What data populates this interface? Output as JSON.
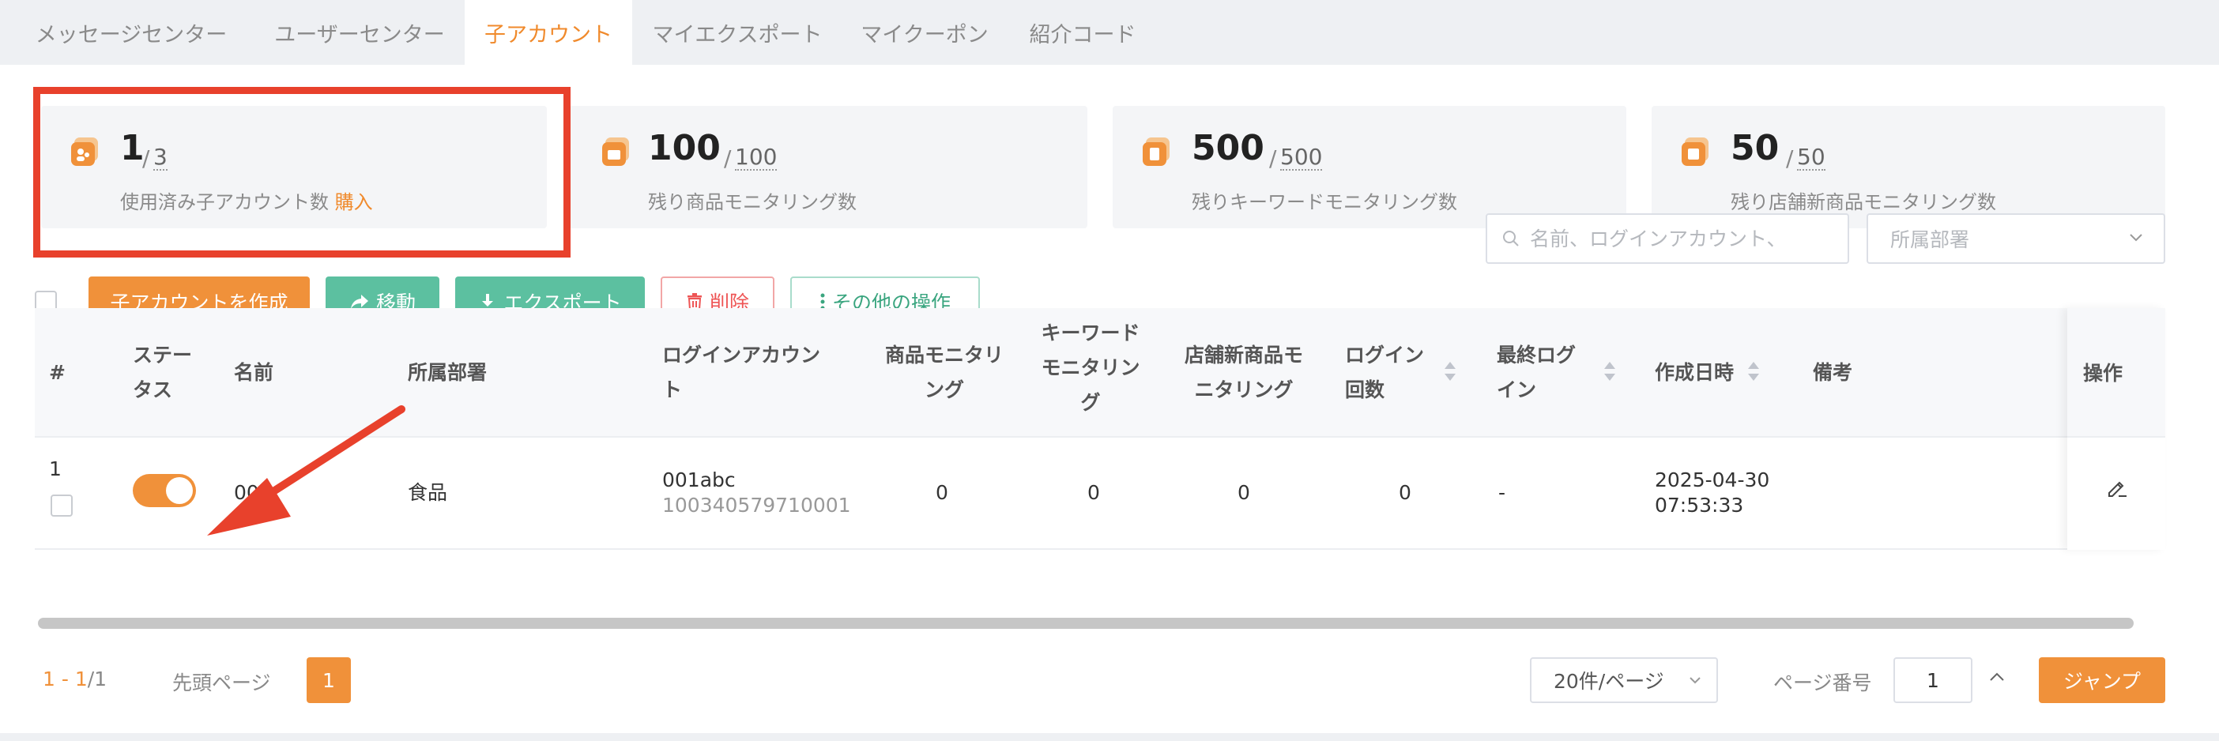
{
  "tabs": [
    {
      "label": "メッセージセンター",
      "active": false
    },
    {
      "label": "ユーザーセンター",
      "active": false
    },
    {
      "label": "子アカウント",
      "active": true
    },
    {
      "label": "マイエクスポート",
      "active": false
    },
    {
      "label": "マイクーポン",
      "active": false
    },
    {
      "label": "紹介コード",
      "active": false
    }
  ],
  "stats": [
    {
      "value": "1",
      "total": "3",
      "label": "使用済み子アカウント数",
      "action": "購入"
    },
    {
      "value": "100",
      "total": "100",
      "label": "残り商品モニタリング数"
    },
    {
      "value": "500",
      "total": "500",
      "label": "残りキーワードモニタリング数"
    },
    {
      "value": "50",
      "total": "50",
      "label": "残り店舗新商品モニタリング数"
    }
  ],
  "toolbar": {
    "create": "子アカウントを作成",
    "move": "移動",
    "export": "エクスポート",
    "delete": "削除",
    "more": "その他の操作",
    "search_placeholder": "名前、ログインアカウント、",
    "dept_placeholder": "所属部署"
  },
  "table": {
    "headers": {
      "index": "#",
      "status_1": "ステー",
      "status_2": "タス",
      "name": "名前",
      "dept": "所属部署",
      "login_1": "ログインアカウン",
      "login_2": "ト",
      "product_1": "商品モニタリ",
      "product_2": "ング",
      "keyword_1": "キーワード",
      "keyword_2": "モニタリン",
      "keyword_3": "グ",
      "shop_1": "店舗新商品モ",
      "shop_2": "ニタリング",
      "logins_1": "ログイン",
      "logins_2": "回数",
      "last_1": "最終ログ",
      "last_2": "イン",
      "created": "作成日時",
      "note": "備考",
      "ops": "操作"
    },
    "rows": [
      {
        "index": "1",
        "status_on": true,
        "name": "001",
        "dept": "食品",
        "login": "001abc",
        "login_id": "100340579710001",
        "product": "0",
        "keyword": "0",
        "shop": "0",
        "logins": "0",
        "last_login": "-",
        "created_date": "2025-04-30",
        "created_time": "07:53:33",
        "note": ""
      }
    ]
  },
  "pagination": {
    "range": "1 - 1",
    "total": "/1",
    "first": "先頭ページ",
    "current": "1",
    "page_size": "20件/ページ",
    "page_label": "ページ番号",
    "page_input": "1",
    "jump": "ジャンプ"
  },
  "colors": {
    "accent": "#f0913a",
    "green": "#5cc0a0",
    "annotation": "#e8412c"
  }
}
